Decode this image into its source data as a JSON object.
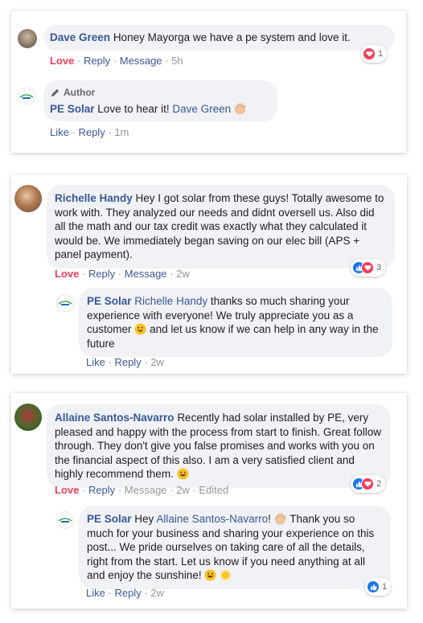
{
  "comments": [
    {
      "author": "Dave Green",
      "text": "Honey Mayorga we have a pe system and love it.",
      "actions": {
        "love": "Love",
        "reply": "Reply",
        "message": "Message",
        "time": "5h"
      },
      "reaction_count": "1",
      "reply": {
        "author_tag": "Author",
        "author": "PE Solar",
        "text": "Love to hear it!",
        "mention": "Dave Green",
        "actions": {
          "like": "Like",
          "reply": "Reply",
          "time": "1m"
        }
      }
    },
    {
      "author": "Richelle Handy",
      "text": "Hey I got solar from these guys! Totally awesome to work with. They analyzed our needs and didnt oversell us. Also did all the math and our tax credit was exactly what they calculated it would be. We immediately began saving on our elec bill (APS + panel payment).",
      "actions": {
        "love": "Love",
        "reply": "Reply",
        "message": "Message",
        "time": "2w"
      },
      "reaction_count": "3",
      "reply": {
        "author": "PE Solar",
        "mention": "Richelle Handy",
        "text_a": "thanks so much sharing your experience with everyone! We truly appreciate you as a customer",
        "text_b": "and let us know if we can help in any way in the future",
        "actions": {
          "like": "Like",
          "reply": "Reply",
          "time": "2w"
        }
      }
    },
    {
      "author": "Allaine Santos-Navarro",
      "text": "Recently had solar installed by PE, very pleased and happy with the process from start to finish. Great follow through. They don't give you false promises and works with you on the financial aspect of this also. I am a very satisfied client and highly recommend them.",
      "actions": {
        "love": "Love",
        "reply": "Reply",
        "message": "Message",
        "time": "2w",
        "edited": "Edited"
      },
      "reaction_count": "2",
      "reply": {
        "author": "PE Solar",
        "greeting": "Hey",
        "mention": "Allaine Santos-Navarro",
        "text_a": "!",
        "text_b": "Thank you so much for your business and sharing your experience on this post... We pride ourselves on taking care of all the details, right from the start. Let us know if you need anything at all and enjoy the sunshine!",
        "actions": {
          "like": "Like",
          "reply": "Reply"
        },
        "reaction_count": "1",
        "time": "2w"
      }
    }
  ],
  "separator": "·",
  "logo_text": "PE Solar",
  "colors": {
    "link": "#385898",
    "love": "#f33e58",
    "like": "#1877f2",
    "bubble": "#f0f2f5"
  }
}
